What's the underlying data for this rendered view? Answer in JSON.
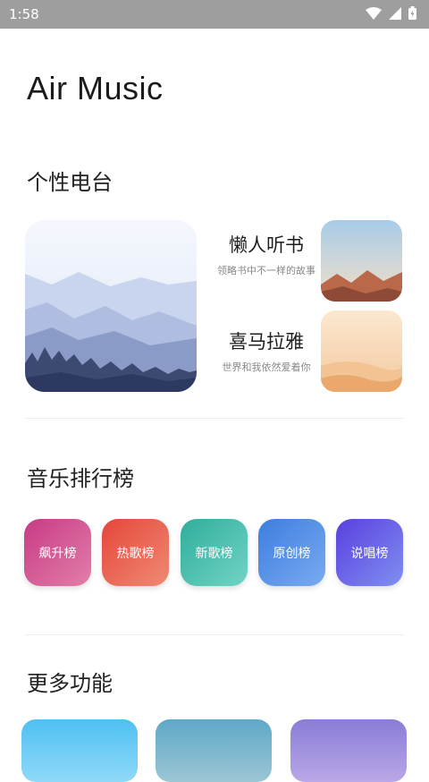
{
  "status_bar": {
    "time": "1:58"
  },
  "app": {
    "title": "Air Music"
  },
  "radio_section": {
    "title": "个性电台",
    "items": [
      {
        "name": "懒人听书",
        "desc": "领略书中不一样的故事"
      },
      {
        "name": "喜马拉雅",
        "desc": "世界和我依然爱着你"
      }
    ]
  },
  "chart_section": {
    "title": "音乐排行榜",
    "items": [
      {
        "label": "飙升榜",
        "colors": [
          "#d63a7a",
          "#e07ab0"
        ]
      },
      {
        "label": "热歌榜",
        "colors": [
          "#e74c3c",
          "#f08a6a"
        ]
      },
      {
        "label": "新歌榜",
        "colors": [
          "#33b3a0",
          "#6fd6c6"
        ]
      },
      {
        "label": "原创榜",
        "colors": [
          "#3f7fe0",
          "#74a8f0"
        ]
      },
      {
        "label": "说唱榜",
        "colors": [
          "#5b3fe0",
          "#8f74f0"
        ]
      }
    ]
  },
  "more_section": {
    "title": "更多功能"
  }
}
